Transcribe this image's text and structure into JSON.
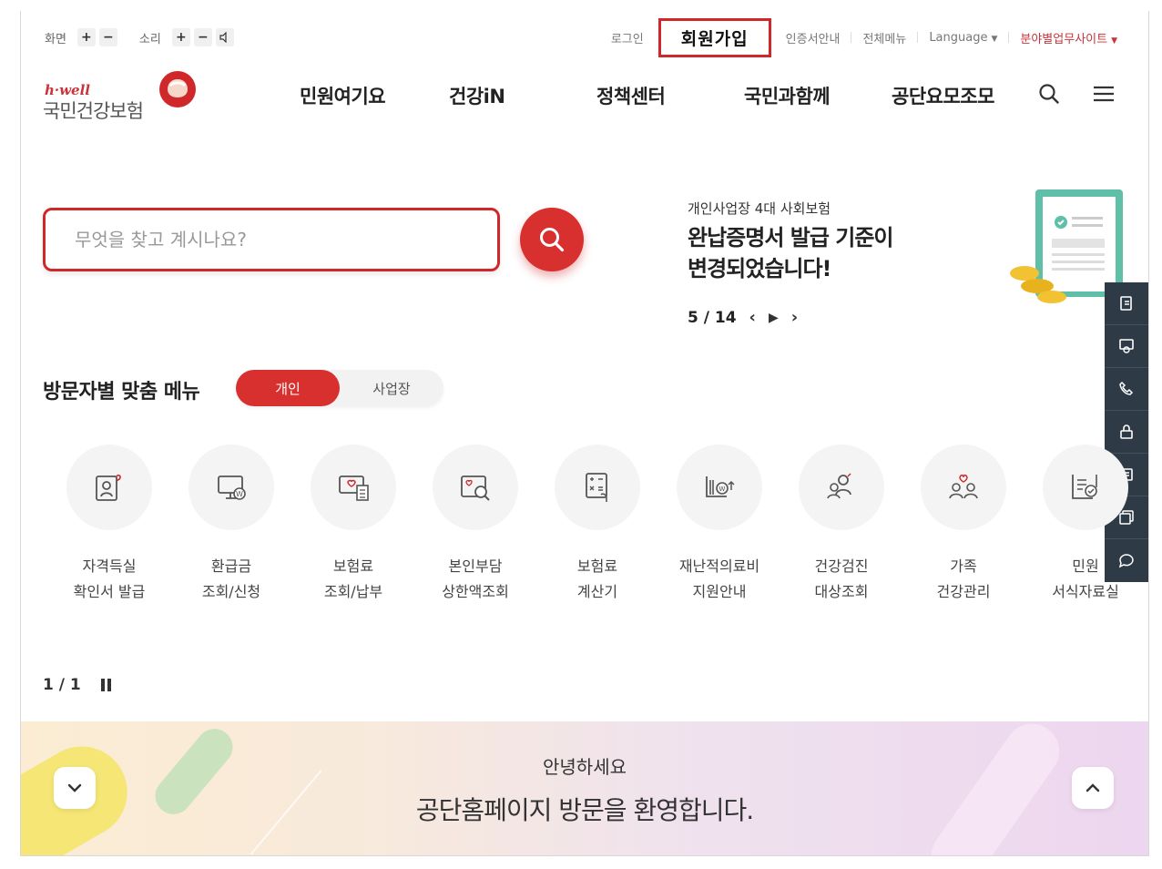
{
  "utility": {
    "screen_label": "화면",
    "sound_label": "소리",
    "plus": "+",
    "minus": "−",
    "login": "로그인",
    "signup": "회원가입",
    "cert": "인증서안내",
    "all_menu": "전체메뉴",
    "language": "Language",
    "family_site": "분야별업무사이트"
  },
  "header": {
    "logo_en": "h·well",
    "logo_ko": "국민건강보험",
    "nav": [
      "민원여기요",
      "건강iN",
      "정책센터",
      "국민과함께",
      "공단요모조모"
    ]
  },
  "search": {
    "placeholder": "무엇을 찾고 계시나요?"
  },
  "banner": {
    "subtitle": "개인사업장 4대 사회보험",
    "title_line1": "완납증명서 발급 기준이",
    "title_line2": "변경되었습니다!",
    "counter": "5 / 14"
  },
  "quick_bar": {
    "icons": [
      "document-transfer-icon",
      "certificate-icon",
      "phone-call-icon",
      "lock-icon",
      "form-icon",
      "copy-icon",
      "chat-icon"
    ]
  },
  "visitor_menu": {
    "title": "방문자별 맞춤 메뉴",
    "tabs": [
      "개인",
      "사업장"
    ],
    "active_tab": "개인",
    "items": [
      {
        "label": "자격득실\n확인서 발급",
        "icon": "user-check-icon"
      },
      {
        "label": "환급금\n조회/신청",
        "icon": "refund-monitor-icon"
      },
      {
        "label": "보험료\n조회/납부",
        "icon": "insurance-pay-icon"
      },
      {
        "label": "본인부담\n상한액조회",
        "icon": "search-document-icon"
      },
      {
        "label": "보험료\n계산기",
        "icon": "calculator-icon"
      },
      {
        "label": "재난적의료비\n지원안내",
        "icon": "medical-support-icon"
      },
      {
        "label": "건강검진\n대상조회",
        "icon": "people-search-icon"
      },
      {
        "label": "가족\n건강관리",
        "icon": "family-icon"
      },
      {
        "label": "민원\n서식자료실",
        "icon": "forms-library-icon"
      }
    ],
    "pager": "1 / 1"
  },
  "welcome": {
    "hello": "안녕하세요",
    "message": "공단홈페이지 방문을 환영합니다."
  },
  "colors": {
    "brand_red": "#d0282a",
    "quick_bar_bg": "#2f3a47"
  }
}
